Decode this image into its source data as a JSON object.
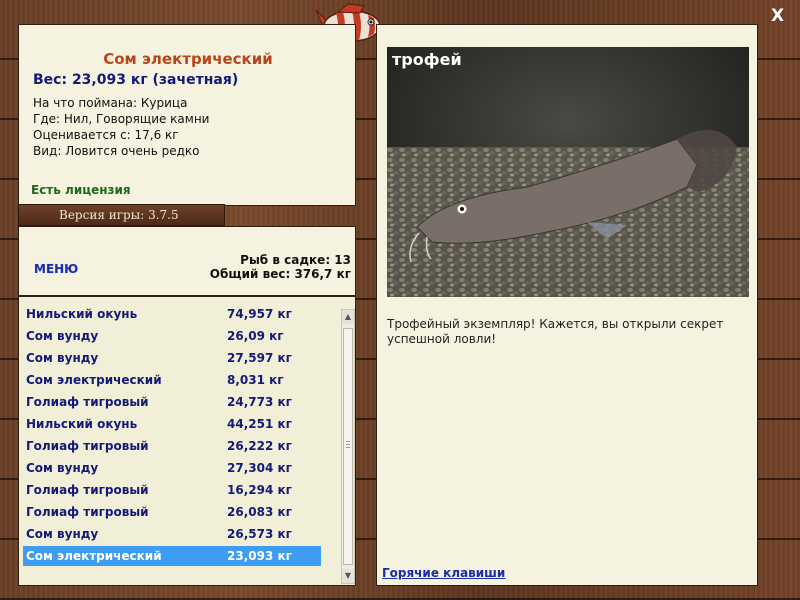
{
  "fish_info": {
    "name": "Сом электрический",
    "weight_line": "Вес: 23,093 кг (зачетная)",
    "bait_line": "На что поймана: Курица",
    "where_line": "Где: Нил, Говорящие камни",
    "value_line": "Оценивается с: 17,6 кг",
    "rarity_line": "Вид: Ловится очень редко",
    "license": "Есть лицензия"
  },
  "version": "Версия игры: 3.7.5",
  "menu_label": "МЕНЮ",
  "keepnet": {
    "count_line": "Рыб в садке: 13",
    "total_line": "Общий вес: 376,7 кг"
  },
  "catch_list": [
    {
      "name": "Нильский окунь",
      "weight": "74,957 кг"
    },
    {
      "name": "Сом вунду",
      "weight": "26,09 кг"
    },
    {
      "name": "Сом вунду",
      "weight": "27,597 кг"
    },
    {
      "name": "Сом электрический",
      "weight": "8,031 кг"
    },
    {
      "name": "Голиаф тигровый",
      "weight": "24,773 кг"
    },
    {
      "name": "Нильский окунь",
      "weight": "44,251 кг"
    },
    {
      "name": "Голиаф тигровый",
      "weight": "26,222 кг"
    },
    {
      "name": "Сом вунду",
      "weight": "27,304 кг"
    },
    {
      "name": "Голиаф тигровый",
      "weight": "16,294 кг"
    },
    {
      "name": "Голиаф тигровый",
      "weight": "26,083 кг"
    },
    {
      "name": "Сом вунду",
      "weight": "26,573 кг"
    },
    {
      "name": "Сом электрический",
      "weight": "23,093 кг"
    }
  ],
  "selected_index": 11,
  "photo_badge": "трофей",
  "description": "Трофейный экземпляр! Кажется, вы открыли секрет успешной ловли!",
  "hotkeys_link": "Горячие клавиши",
  "close_label": "X",
  "colors": {
    "title": "#b9461a",
    "weight": "#131a78",
    "license": "#1c6b1c",
    "link": "#1a2ea5",
    "selection": "#3d9df2"
  },
  "icons": [
    "fish-logo-icon",
    "close-icon",
    "scroll-up-icon",
    "scroll-down-icon"
  ]
}
